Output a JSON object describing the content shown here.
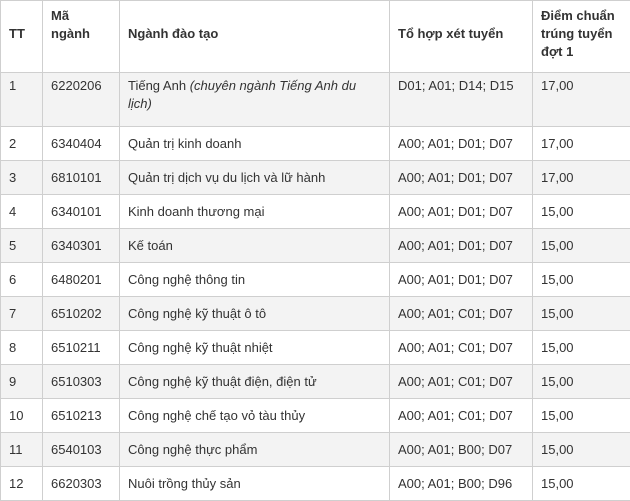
{
  "headers": {
    "tt": "TT",
    "code": "Mã ngành",
    "name": "Ngành đào tạo",
    "combo": "Tổ hợp xét tuyển",
    "score": "Điểm chuẩn trúng tuyển đợt 1"
  },
  "rows": [
    {
      "tt": "1",
      "code": "6220206",
      "name": "Tiếng Anh",
      "note": "(chuyên ngành Tiếng Anh du lịch)",
      "combo": "D01; A01; D14; D15",
      "score": "17,00"
    },
    {
      "tt": "2",
      "code": "6340404",
      "name": "Quản trị kinh doanh",
      "combo": "A00; A01; D01; D07",
      "score": "17,00"
    },
    {
      "tt": "3",
      "code": "6810101",
      "name": "Quản trị dịch vụ du lịch và lữ hành",
      "combo": "A00; A01; D01; D07",
      "score": "17,00"
    },
    {
      "tt": "4",
      "code": "6340101",
      "name": "Kinh doanh thương mại",
      "combo": "A00; A01; D01; D07",
      "score": "15,00"
    },
    {
      "tt": "5",
      "code": "6340301",
      "name": "Kế toán",
      "combo": "A00; A01; D01; D07",
      "score": "15,00"
    },
    {
      "tt": "6",
      "code": "6480201",
      "name": "Công nghệ thông tin",
      "combo": "A00; A01; D01; D07",
      "score": "15,00"
    },
    {
      "tt": "7",
      "code": "6510202",
      "name": "Công nghệ kỹ thuật ô tô",
      "combo": "A00; A01; C01; D07",
      "score": "15,00"
    },
    {
      "tt": "8",
      "code": "6510211",
      "name": "Công nghệ kỹ thuật nhiệt",
      "combo": "A00; A01; C01; D07",
      "score": "15,00"
    },
    {
      "tt": "9",
      "code": "6510303",
      "name": "Công nghệ kỹ thuật điện, điện tử",
      "combo": "A00; A01; C01; D07",
      "score": "15,00"
    },
    {
      "tt": "10",
      "code": "6510213",
      "name": "Công nghệ chế tạo vỏ tàu thủy",
      "combo": "A00; A01; C01; D07",
      "score": "15,00"
    },
    {
      "tt": "11",
      "code": "6540103",
      "name": "Công nghệ thực phẩm",
      "combo": "A00; A01; B00; D07",
      "score": "15,00"
    },
    {
      "tt": "12",
      "code": "6620303",
      "name": "Nuôi trồng thủy sản",
      "combo": "A00; A01; B00; D96",
      "score": "15,00"
    }
  ]
}
